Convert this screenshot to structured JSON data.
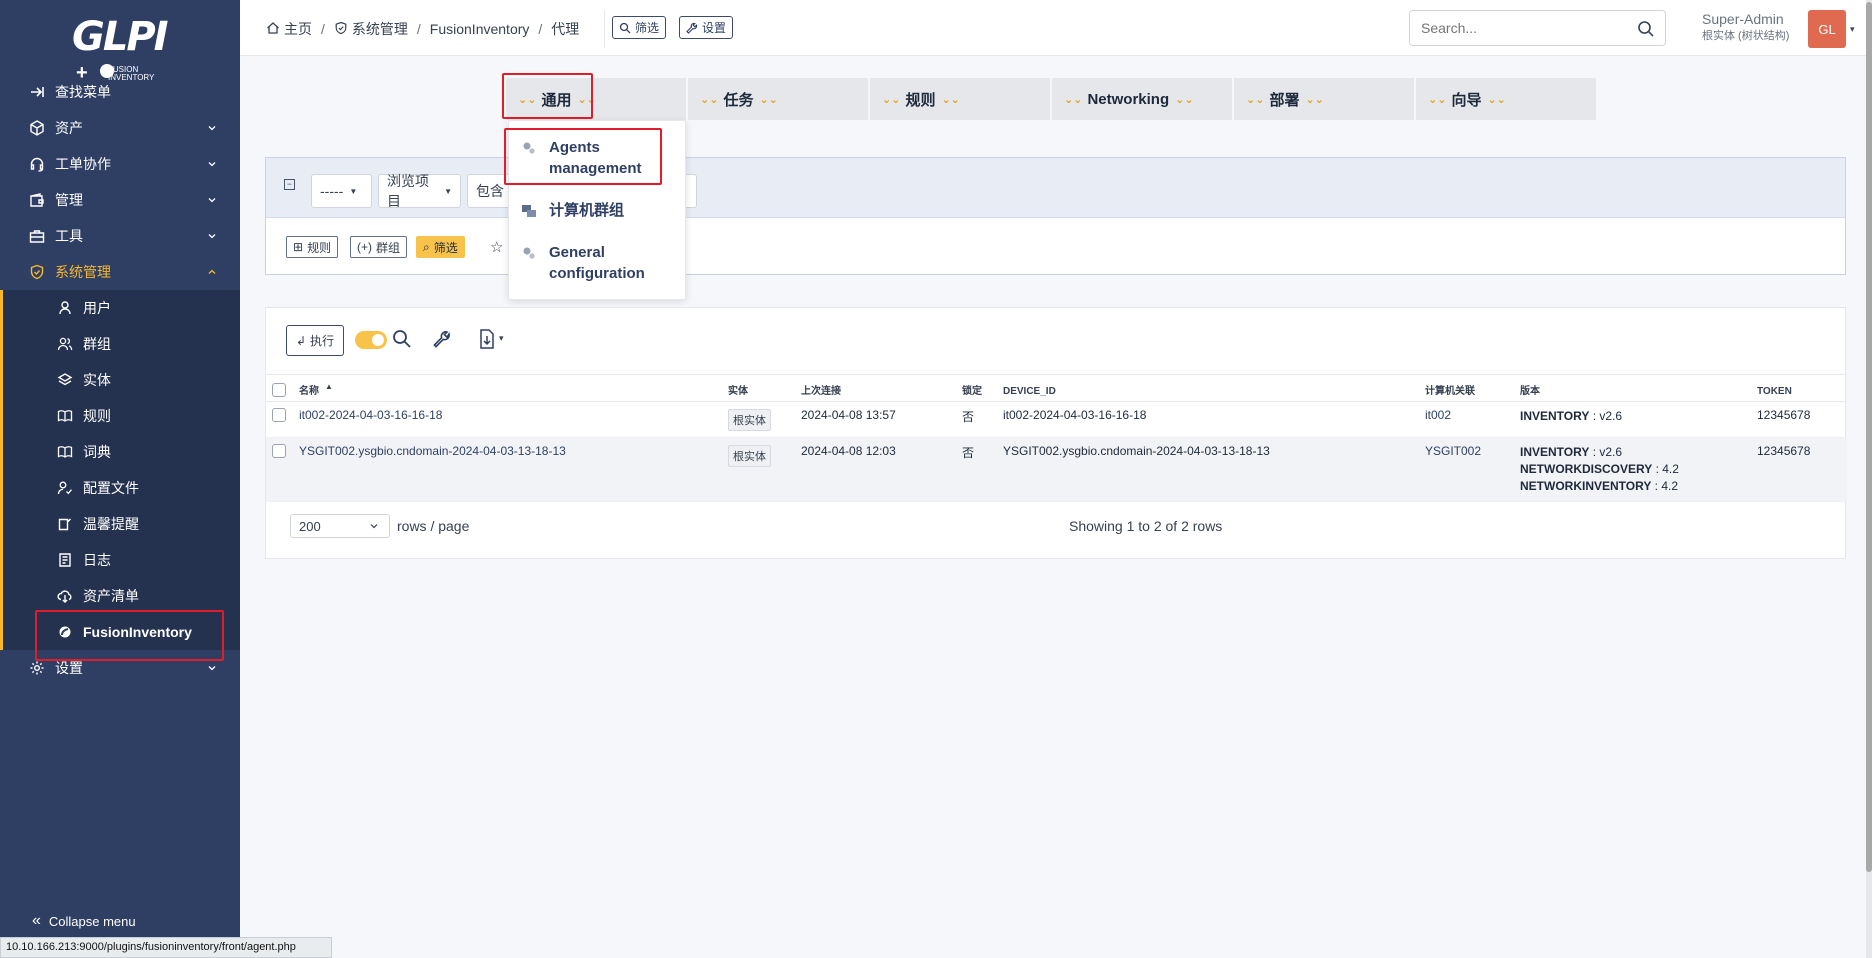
{
  "app": {
    "logo_text": "GLPI",
    "logo_sub": "FUSION INVENTORY"
  },
  "sidebar": {
    "items": [
      {
        "label": "查找菜单",
        "icon": "arrow-right-icon"
      },
      {
        "label": "资产",
        "icon": "cube-icon"
      },
      {
        "label": "工单协作",
        "icon": "headset-icon"
      },
      {
        "label": "管理",
        "icon": "wallet-icon"
      },
      {
        "label": "工具",
        "icon": "briefcase-icon"
      },
      {
        "label": "系统管理",
        "icon": "shield-icon"
      }
    ],
    "subitems": [
      {
        "label": "用户",
        "icon": "user-icon"
      },
      {
        "label": "群组",
        "icon": "users-icon"
      },
      {
        "label": "实体",
        "icon": "layers-icon"
      },
      {
        "label": "规则",
        "icon": "book-icon"
      },
      {
        "label": "词典",
        "icon": "book-icon"
      },
      {
        "label": "配置文件",
        "icon": "user-check-icon"
      },
      {
        "label": "温馨提醒",
        "icon": "note-icon"
      },
      {
        "label": "日志",
        "icon": "log-icon"
      },
      {
        "label": "资产清单",
        "icon": "cloud-download-icon"
      },
      {
        "label": "FusionInventory",
        "icon": "fusion-icon"
      }
    ],
    "settings": {
      "label": "设置",
      "icon": "gear-icon"
    },
    "collapse_label": "Collapse menu"
  },
  "header": {
    "breadcrumb": [
      "主页",
      "系统管理",
      "FusionInventory",
      "代理"
    ],
    "filter_btn": "筛选",
    "settings_btn": "设置",
    "search_placeholder": "Search...",
    "user_name": "Super-Admin",
    "user_entity": "根实体 (树状结构)",
    "avatar_initials": "GL"
  },
  "plugin_tabs": [
    "通用",
    "任务",
    "规则",
    "Networking",
    "部署",
    "向导"
  ],
  "dropdown": {
    "items": [
      {
        "label_line1": "Agents",
        "label_line2": "management",
        "icon": "gears-icon"
      },
      {
        "label_line1": "计算机群组",
        "label_line2": "",
        "icon": "computers-icon"
      },
      {
        "label_line1": "General",
        "label_line2": "configuration",
        "icon": "gears-icon"
      }
    ]
  },
  "search_form": {
    "field_select": "-----",
    "browse_select": "浏览项目",
    "operator_select": "包含",
    "rule_btn": "规则",
    "group_btn": "群组",
    "filter_btn": "筛选"
  },
  "results": {
    "execute_btn": "执行",
    "columns": [
      "名称",
      "实体",
      "上次连接",
      "锁定",
      "DEVICE_ID",
      "计算机关联",
      "版本",
      "TOKEN"
    ],
    "rows": [
      {
        "name": "it002-2024-04-03-16-16-18",
        "entity": "根实体",
        "last_contact": "2024-04-08 13:57",
        "locked": "否",
        "device_id": "it002-2024-04-03-16-16-18",
        "computer": "it002",
        "versions": [
          {
            "k": "INVENTORY",
            "v": " : v2.6"
          }
        ],
        "token": "12345678"
      },
      {
        "name": "YSGIT002.ysgbio.cndomain-2024-04-03-13-18-13",
        "entity": "根实体",
        "last_contact": "2024-04-08 12:03",
        "locked": "否",
        "device_id": "YSGIT002.ysgbio.cndomain-2024-04-03-13-18-13",
        "computer": "YSGIT002",
        "versions": [
          {
            "k": "INVENTORY",
            "v": " : v2.6"
          },
          {
            "k": "NETWORKDISCOVERY",
            "v": " : 4.2"
          },
          {
            "k": "NETWORKINVENTORY",
            "v": " : 4.2"
          }
        ],
        "token": "12345678"
      }
    ],
    "page_size": "200",
    "rows_per_page_label": "rows / page",
    "showing": "Showing 1 to 2 of 2 rows"
  },
  "statusbar": {
    "url": "10.10.166.213:9000/plugins/fusioninventory/front/agent.php"
  },
  "colors": {
    "sidebar": "#2f3f64",
    "accent": "#f8b82b",
    "highlight": "#e11d2b"
  }
}
